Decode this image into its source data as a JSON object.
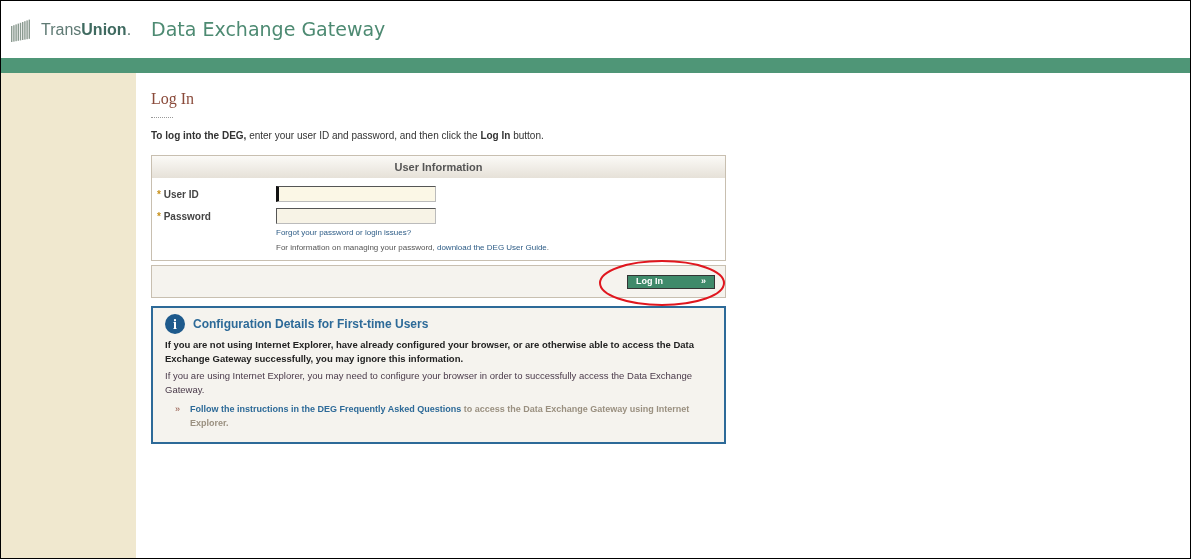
{
  "header": {
    "brand_light": "Trans",
    "brand_bold": "Union",
    "brand_mark": ".",
    "title": "Data Exchange Gateway"
  },
  "page": {
    "heading": "Log In",
    "intro": "**To log into the DEG,** enter your user ID and password, and then click the **Log In** button."
  },
  "form": {
    "title": "User Information",
    "fields": [
      {
        "label": "User ID",
        "required_mark": "*",
        "focused": true
      },
      {
        "label": "Password",
        "required_mark": "*",
        "focused": false
      }
    ],
    "forgot_link": "Forgot your password or login issues?",
    "info_text": "For information on managing your password, ",
    "info_link": "download the DEG User Guide",
    "info_end": ".",
    "submit": {
      "label": "Log In",
      "arrow": "»",
      "highlighted": true
    }
  },
  "notice": {
    "icon": "i",
    "title": "Configuration Details for First-time Users",
    "bold_text": "If you are not using Internet Explorer, have already configured your browser, or are otherwise able to access the Data Exchange Gateway successfully, you may ignore this information.",
    "text": "If you are using Internet Explorer, you may need to configure your browser in order to successfully access the Data Exchange Gateway.",
    "bullet": "»",
    "link": "Follow the instructions in the DEG Frequently Asked Questions",
    "link_after": " to access the Data Exchange Gateway using Internet Explorer."
  }
}
